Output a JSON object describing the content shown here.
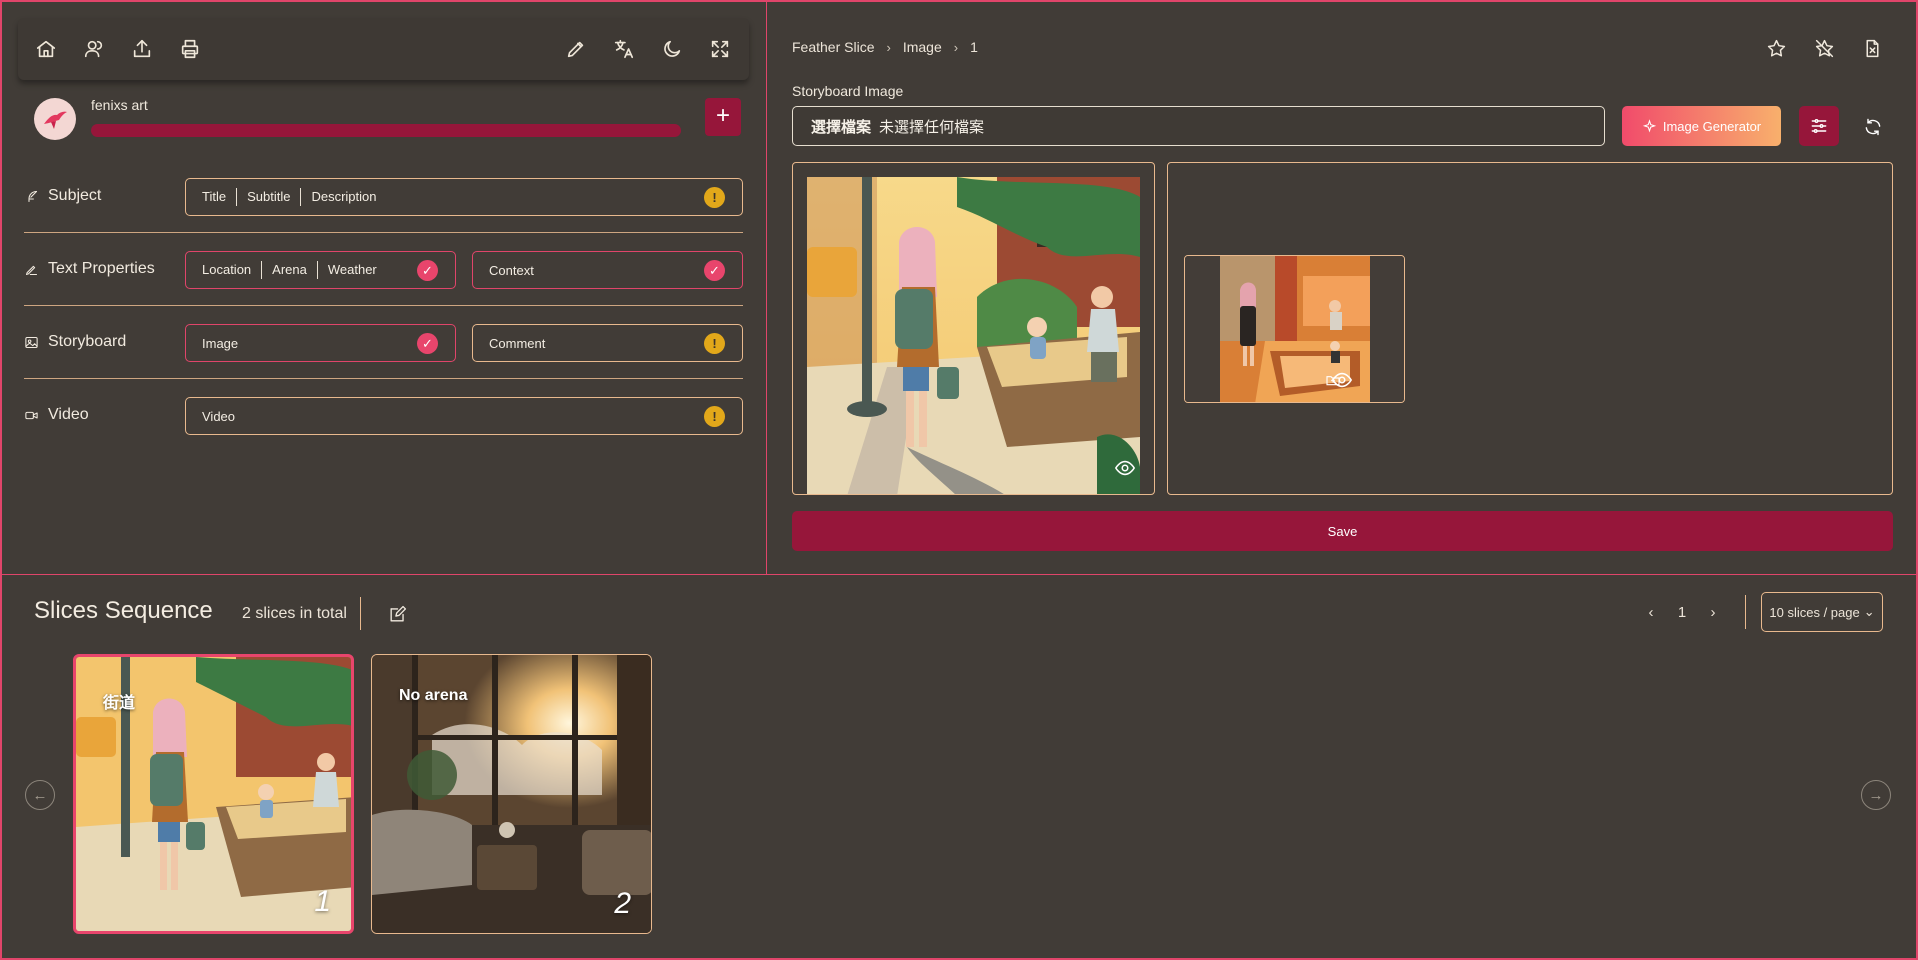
{
  "toolbar": {
    "left_icons": [
      "home-icon",
      "users-icon",
      "upload-icon",
      "printer-icon"
    ],
    "right_icons": [
      "pencil-icon",
      "translate-icon",
      "moon-icon",
      "fullscreen-icon"
    ]
  },
  "user": {
    "name": "fenixs art",
    "add_label": "+"
  },
  "sections": {
    "subject": {
      "label": "Subject",
      "parts": [
        "Title",
        "Subtitle",
        "Description"
      ]
    },
    "text_properties": {
      "label": "Text Properties",
      "parts": [
        "Location",
        "Arena",
        "Weather"
      ],
      "context": "Context"
    },
    "storyboard": {
      "label": "Storyboard",
      "image": "Image",
      "comment": "Comment"
    },
    "video": {
      "label": "Video",
      "field": "Video"
    }
  },
  "breadcrumb": [
    "Feather Slice",
    "Image",
    "1"
  ],
  "right_icons": [
    "star-icon",
    "star-off-icon",
    "file-x-icon"
  ],
  "storyboard_image": {
    "label": "Storyboard Image",
    "choose_file": "選擇檔案",
    "no_file": "未選擇任何檔案",
    "generator_label": "Image Generator",
    "save_label": "Save"
  },
  "sequence": {
    "title": "Slices Sequence",
    "count": "2 slices in total",
    "page": "1",
    "prev": "‹",
    "next": "›",
    "per_page": "10 slices / page",
    "slices": [
      {
        "label": "街道",
        "number": "1"
      },
      {
        "label": "No arena",
        "number": "2"
      }
    ]
  },
  "colors": {
    "accent": "#e0456a",
    "primary": "#96163a",
    "warning": "#e2a81a",
    "border": "#e8b98e",
    "background": "#413c37"
  }
}
